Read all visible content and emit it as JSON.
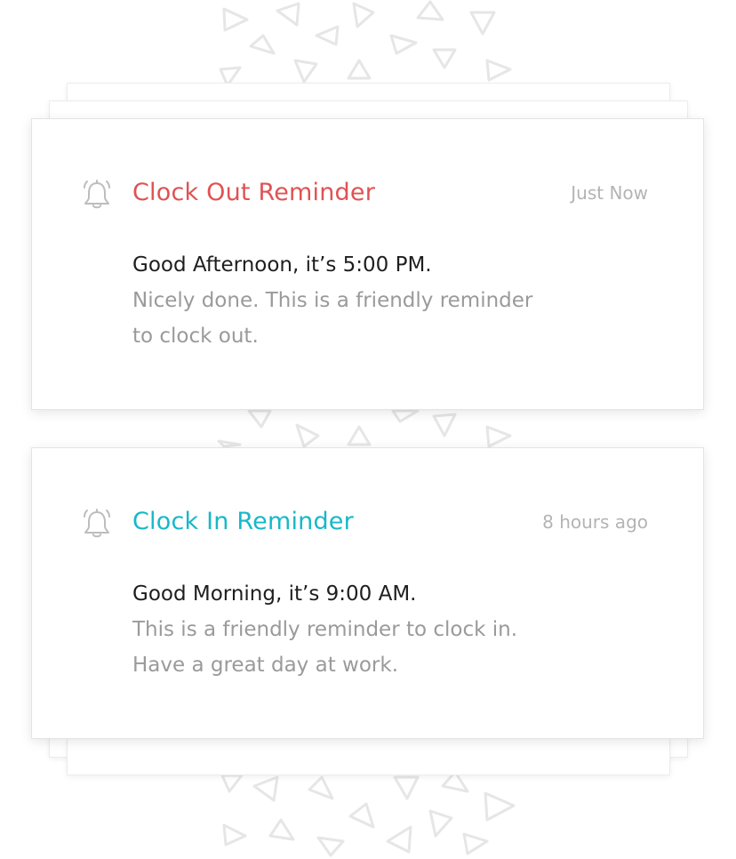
{
  "notifications": [
    {
      "title": "Clock Out Reminder",
      "time": "Just Now",
      "greeting": "Good Afternoon, it’s 5:00 PM.",
      "message_line1": "Nicely done. This is a friendly reminder",
      "message_line2": "to clock out.",
      "accent_color": "#e05253",
      "icon": "bell-icon"
    },
    {
      "title": "Clock In Reminder",
      "time": "8 hours ago",
      "greeting": "Good Morning, it’s 9:00 AM.",
      "message_line1": "This is a friendly reminder to clock in.",
      "message_line2": "Have a great day at work.",
      "accent_color": "#17b8c8",
      "icon": "bell-icon"
    }
  ],
  "colors": {
    "pattern": "#e6e6e6",
    "card_border": "#e4e4e4",
    "timestamp": "#b4b4b4",
    "greeting": "#1e1e1e",
    "message": "#9a9a9a",
    "icon": "#bdbdbd"
  }
}
